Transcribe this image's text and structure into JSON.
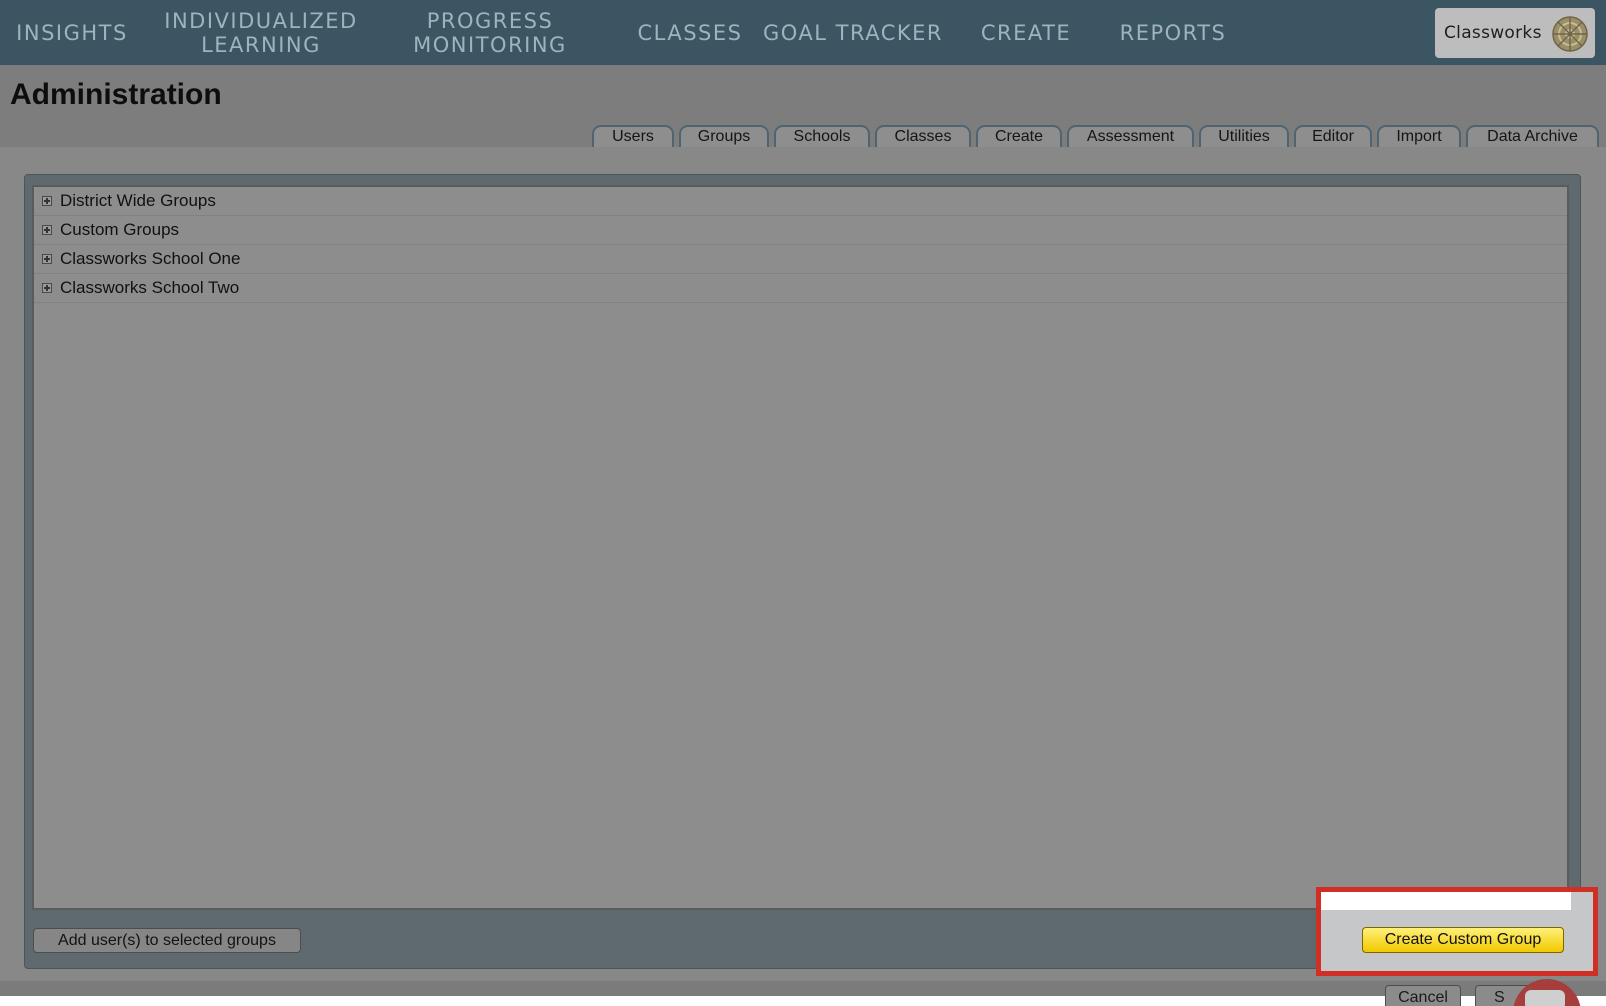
{
  "nav": {
    "items": [
      {
        "label": "INSIGHTS"
      },
      {
        "label": "INDIVIDUALIZED\nLEARNING"
      },
      {
        "label": "PROGRESS\nMONITORING"
      },
      {
        "label": "CLASSES"
      },
      {
        "label": "GOAL TRACKER"
      },
      {
        "label": "CREATE"
      },
      {
        "label": "REPORTS"
      }
    ],
    "brand": "Classworks"
  },
  "page": {
    "title": "Administration"
  },
  "tabs": [
    {
      "label": "Users"
    },
    {
      "label": "Groups"
    },
    {
      "label": "Schools"
    },
    {
      "label": "Classes"
    },
    {
      "label": "Create"
    },
    {
      "label": "Assessment"
    },
    {
      "label": "Utilities"
    },
    {
      "label": "Editor"
    },
    {
      "label": "Import"
    },
    {
      "label": "Data Archive"
    }
  ],
  "tree": {
    "items": [
      {
        "label": "District Wide Groups"
      },
      {
        "label": "Custom Groups"
      },
      {
        "label": "Classworks School One"
      },
      {
        "label": "Classworks School Two"
      }
    ]
  },
  "actions": {
    "add_users": "Add user(s) to selected groups",
    "create_custom_group": "Create Custom Group",
    "cancel": "Cancel",
    "save_partial": "S"
  },
  "colors": {
    "nav_bg": "#3b5562",
    "nav_text": "#9fb3bd",
    "highlight": "#d12e26",
    "primary_button": "#f2c800"
  }
}
